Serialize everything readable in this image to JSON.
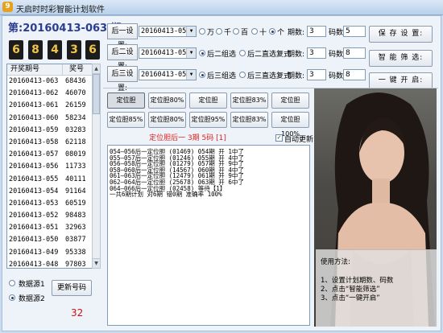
{
  "window": {
    "title": "天启时时彩智能计划软件",
    "logo": "9"
  },
  "left": {
    "period_label": "第:20160413-063 期",
    "digits": [
      "6",
      "8",
      "4",
      "3",
      "6"
    ],
    "history": {
      "headers": [
        "开奖期号",
        "奖号"
      ],
      "rows": [
        [
          "20160413-063",
          "68436"
        ],
        [
          "20160413-062",
          "46070"
        ],
        [
          "20160413-061",
          "26159"
        ],
        [
          "20160413-060",
          "58234"
        ],
        [
          "20160413-059",
          "03283"
        ],
        [
          "20160413-058",
          "62118"
        ],
        [
          "20160413-057",
          "08019"
        ],
        [
          "20160413-056",
          "11733"
        ],
        [
          "20160413-055",
          "40111"
        ],
        [
          "20160413-054",
          "91164"
        ],
        [
          "20160413-053",
          "60519"
        ],
        [
          "20160413-052",
          "98483"
        ],
        [
          "20160413-051",
          "32963"
        ],
        [
          "20160413-050",
          "03877"
        ],
        [
          "20160413-049",
          "95338"
        ],
        [
          "20160413-048",
          "97803"
        ],
        [
          "20160413-047",
          "79762"
        ]
      ]
    },
    "source1": "数据源1",
    "source2": "数据源2",
    "update_button": "更新号码",
    "bottom_value": "32"
  },
  "settings": {
    "row1": {
      "label": "后一设置:",
      "select": "20160413-054",
      "options": [
        "万",
        "千",
        "百",
        "十",
        "个"
      ],
      "selected": "个",
      "periods_label": "期数:",
      "periods": "3",
      "codes_label": "码数:",
      "codes": "5"
    },
    "row2": {
      "label": "后二设置:",
      "select": "20160413-054",
      "options": [
        "后二组选",
        "后二直选复式"
      ],
      "selected": "后二组选",
      "periods_label": "期数:",
      "periods": "3",
      "codes_label": "码数:",
      "codes": "8"
    },
    "row3": {
      "label": "后三设置:",
      "select": "20160413-054",
      "options": [
        "后三组选",
        "后三直选复式"
      ],
      "selected": "后三组选",
      "periods_label": "期数:",
      "periods": "3",
      "codes_label": "码数:",
      "codes": "8"
    }
  },
  "actions": {
    "save": "保 存 设 置:",
    "filter": "智 能 筛 选:",
    "start": "一 键 开 启:"
  },
  "positions": [
    [
      "定位胆100%",
      "定位胆80%",
      "定位胆100%",
      "定位胆83%",
      "定位胆100%"
    ],
    [
      "定位胆85%",
      "定位胆80%",
      "定位胆95%",
      "定位胆83%",
      "定位胆100%"
    ]
  ],
  "status": {
    "text": "定位胆后一  3期  5码  [1]",
    "auto_update_label": "自动更新",
    "auto_update": true
  },
  "output": {
    "lines": [
      "054—056后一定位胆 (01469) 054期 开 1中了",
      "055—057后一定位胆 (01246) 055期 开 4中了",
      "056—058后一定位胆 (01279) 057期 开 9中了",
      "058—060后一定位胆 (14567) 060期 开 4中了",
      "061—063后一定位胆 (12479) 061期 开 9中了",
      "062—064后一定位胆 (25678) 063期 开 6中了",
      "064—066后一定位胆 (02458) 等待【1】",
      "",
      "一共6期计划 对6期 错0期 准确率 100%"
    ]
  },
  "usage": {
    "title": "使用方法:",
    "steps": [
      "1、设置计划期数、码数",
      "2、点击“智能筛选”",
      "3、点击“一键开启”"
    ]
  }
}
